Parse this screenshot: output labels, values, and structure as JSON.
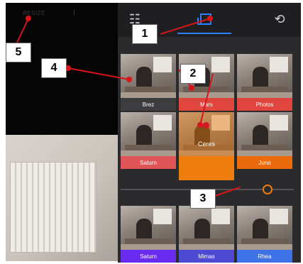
{
  "preview": {
    "label": "RESIZE"
  },
  "tabs": [
    {
      "name": "adjust",
      "glyph": "☷"
    },
    {
      "name": "filters",
      "glyph": ""
    },
    {
      "name": "transform",
      "glyph": "⟲"
    }
  ],
  "filters": {
    "row1": [
      "Brez",
      "Mars",
      "Photos"
    ],
    "row2": [
      "Saturn",
      "Ceres",
      "Juno"
    ],
    "row3": [
      "Saturn",
      "Mimas",
      "Rhea"
    ],
    "selected": "Ceres",
    "colors": {
      "Brez": "#3d3d40",
      "Mars": "#e0463d",
      "Photos": "#e0463d",
      "Saturn_row2": "#e05555",
      "Ceres": "#ee7d0e",
      "Juno": "#ea6a0c",
      "Saturn": "#6a2cf0",
      "Mimas": "#4e49d3",
      "Rhea": "#3f72e6"
    }
  },
  "slider": {
    "value": 0.85,
    "accent": "#ee7d0e"
  },
  "callouts": [
    "1",
    "2",
    "3",
    "4",
    "5"
  ],
  "accent": "#2f80ff"
}
